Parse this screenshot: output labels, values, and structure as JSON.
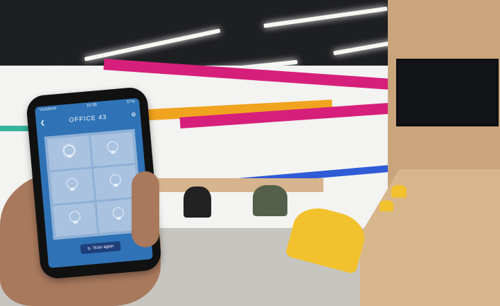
{
  "phone_app": {
    "status": {
      "carrier": "Vodafone",
      "time": "10:38",
      "battery": "57%"
    },
    "title": "OFFICE 43",
    "back_icon": "chevron-left-icon",
    "settings_icon": "gear-icon",
    "lights": [
      {
        "icon": "lightbulb-icon",
        "state": "on"
      },
      {
        "icon": "lightbulb-icon",
        "state": "off"
      },
      {
        "icon": "lightbulb-icon",
        "state": "off"
      },
      {
        "icon": "lightbulb-icon",
        "state": "off"
      },
      {
        "icon": "lightbulb-icon",
        "state": "off"
      },
      {
        "icon": "lightbulb-icon",
        "state": "off"
      }
    ],
    "scan_button": {
      "label": "Scan again",
      "icon": "refresh-icon"
    }
  },
  "colors": {
    "screen": "#2f73b6",
    "stripe_orange": "#f0a31e",
    "stripe_magenta": "#d61f7a",
    "stripe_blue": "#2f5bd6",
    "stripe_teal": "#37b39b",
    "chair_yellow": "#f2c12e"
  }
}
